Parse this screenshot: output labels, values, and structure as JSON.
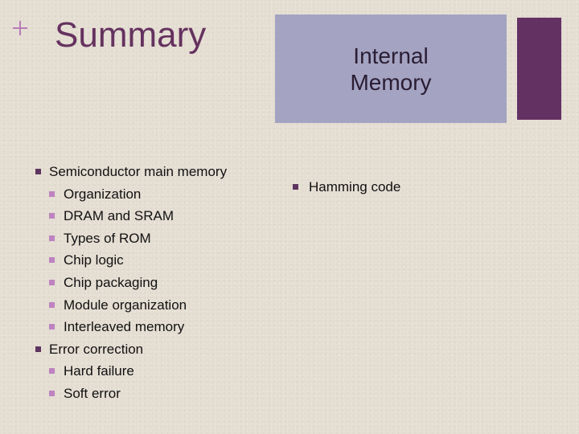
{
  "slide": {
    "title": "Summary",
    "section_label": "Internal\nMemory",
    "colors": {
      "title": "#65325f",
      "section_box": "#a4a3c2",
      "accent_bar": "#643163",
      "bullet_level1": "#5d3560",
      "bullet_level2": "#be83c0",
      "plus_icon": "#b87cb8"
    }
  },
  "left_column": {
    "items": [
      {
        "label": "Semiconductor main memory",
        "level": 1
      },
      {
        "label": "Organization",
        "level": 2
      },
      {
        "label": "DRAM and SRAM",
        "level": 2
      },
      {
        "label": "Types of ROM",
        "level": 2
      },
      {
        "label": "Chip logic",
        "level": 2
      },
      {
        "label": "Chip packaging",
        "level": 2
      },
      {
        "label": "Module organization",
        "level": 2
      },
      {
        "label": "Interleaved memory",
        "level": 2
      },
      {
        "label": "Error correction",
        "level": 1
      },
      {
        "label": "Hard failure",
        "level": 2
      },
      {
        "label": "Soft error",
        "level": 2
      }
    ]
  },
  "right_column": {
    "items": [
      {
        "label": "Hamming code",
        "level": 1
      }
    ]
  }
}
